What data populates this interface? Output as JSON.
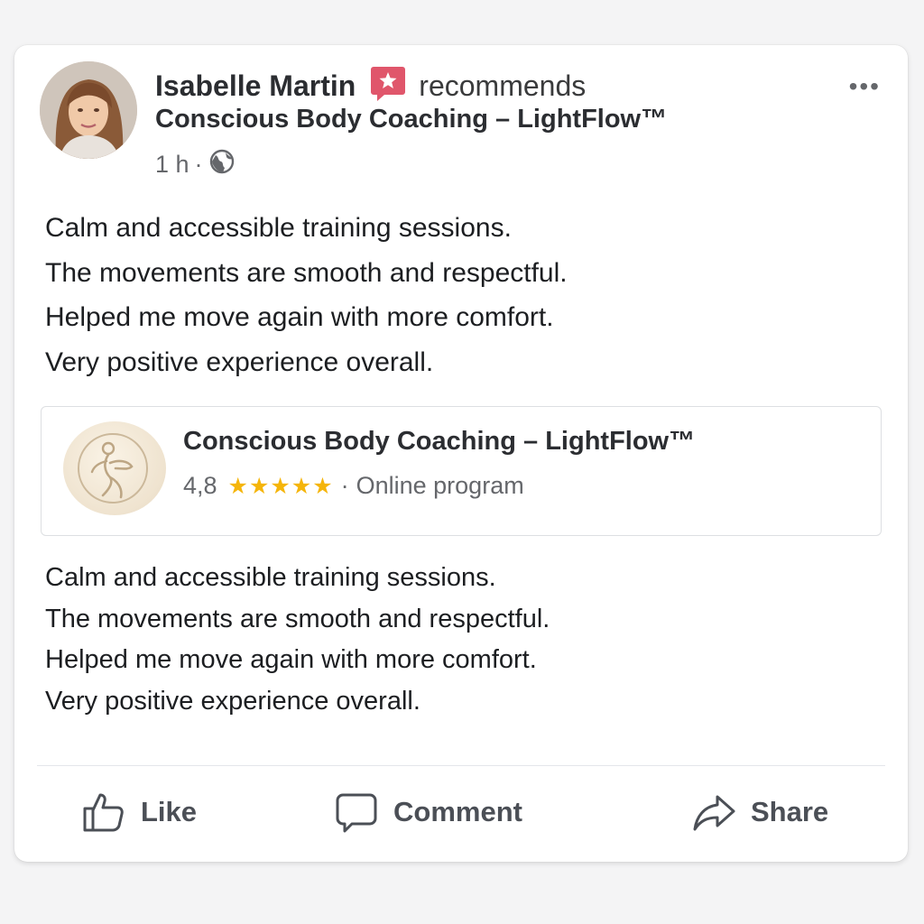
{
  "post": {
    "author": "Isabelle Martin",
    "action_text": "recommends",
    "page_name": "Conscious Body Coaching – LightFlow™",
    "timestamp": "1 h",
    "separator": "·",
    "more_label": "•••",
    "audience_icon": "globe-icon",
    "recommend_icon": "recommend-star-icon",
    "body_lines": [
      "Calm and accessible training sessions.",
      "The movements are smooth and respectful.",
      "Helped me move again with more comfort.",
      "Very positive experience overall."
    ]
  },
  "page_card": {
    "title": "Conscious Body Coaching – LightFlow™",
    "rating": "4,8",
    "stars": "★★★★★",
    "star_count": 5,
    "separator": "·",
    "category": "Online program",
    "logo_icon": "body-figure-logo"
  },
  "review_repeat": {
    "lines": [
      "Calm and accessible training sessions.",
      "The movements are smooth and respectful.",
      "Helped me move again with more comfort.",
      "Very positive experience overall."
    ]
  },
  "actions": {
    "like": "Like",
    "comment": "Comment",
    "share": "Share"
  },
  "colors": {
    "recommend_badge": "#e0566b",
    "stars": "#f5b50a",
    "secondary_text": "#65676b",
    "card_bg": "#ffffff"
  }
}
